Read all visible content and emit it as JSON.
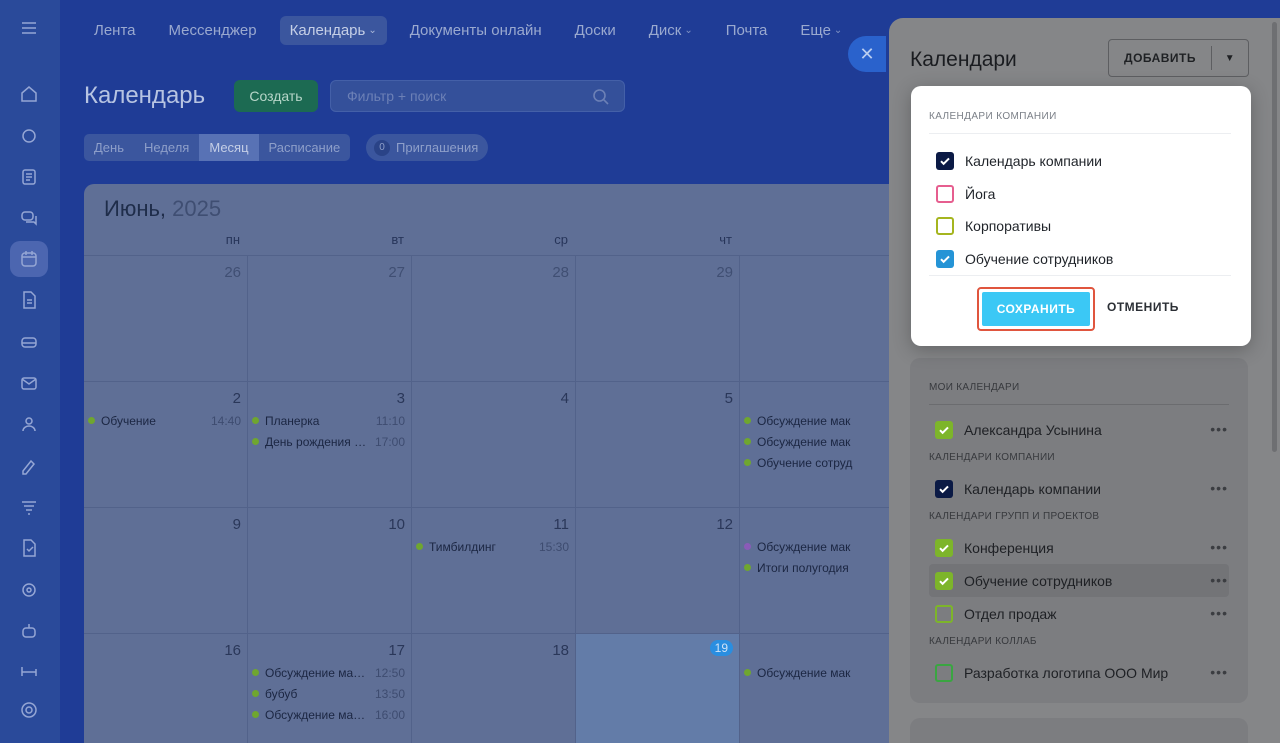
{
  "nav": [
    {
      "label": "Лента",
      "chevron": false,
      "active": false
    },
    {
      "label": "Мессенджер",
      "chevron": false,
      "active": false
    },
    {
      "label": "Календарь",
      "chevron": true,
      "active": true
    },
    {
      "label": "Документы онлайн",
      "chevron": false,
      "active": false
    },
    {
      "label": "Доски",
      "chevron": false,
      "active": false
    },
    {
      "label": "Диск",
      "chevron": true,
      "active": false
    },
    {
      "label": "Почта",
      "chevron": false,
      "active": false
    },
    {
      "label": "Еще",
      "chevron": true,
      "active": false
    }
  ],
  "rail_icons": [
    "menu-icon",
    "home-icon",
    "puzzle-icon",
    "news-icon",
    "chat-icon",
    "calendar-icon",
    "document-icon",
    "drive-icon",
    "mail-icon",
    "team-icon",
    "sign-icon",
    "filter-icon",
    "tasks-icon",
    "target-icon",
    "robot-icon",
    "bed-icon",
    "settings-icon"
  ],
  "toolbar": {
    "title": "Календарь",
    "create_label": "Создать",
    "filter_placeholder": "Фильтр + поиск",
    "views": [
      "День",
      "Неделя",
      "Месяц",
      "Расписание"
    ],
    "active_view": "Месяц",
    "invites_count": "0",
    "invites_label": "Приглашения"
  },
  "calendar": {
    "month": "Июнь,",
    "year": "2025",
    "weekdays": [
      "пн",
      "вт",
      "ср",
      "чт",
      ""
    ],
    "weeks": [
      [
        {
          "n": "26",
          "dim": true,
          "events": []
        },
        {
          "n": "27",
          "dim": true,
          "events": []
        },
        {
          "n": "28",
          "dim": true,
          "events": []
        },
        {
          "n": "29",
          "dim": true,
          "events": []
        },
        {
          "n": "",
          "dim": true,
          "events": []
        }
      ],
      [
        {
          "n": "2",
          "events": [
            {
              "title": "Обучение",
              "time": "14:40",
              "color": "#6fa62f"
            }
          ]
        },
        {
          "n": "3",
          "events": [
            {
              "title": "Планерка",
              "time": "11:10",
              "color": "#6fa62f"
            },
            {
              "title": "День рождения к…",
              "time": "17:00",
              "color": "#6fa62f"
            }
          ]
        },
        {
          "n": "4",
          "events": []
        },
        {
          "n": "5",
          "events": []
        },
        {
          "n": "",
          "events": [
            {
              "title": "Обсуждение мак",
              "time": "",
              "color": "#6fa62f"
            },
            {
              "title": "Обсуждение мак",
              "time": "",
              "color": "#6fa62f"
            },
            {
              "title": "Обучение сотруд",
              "time": "",
              "color": "#6fa62f"
            }
          ]
        }
      ],
      [
        {
          "n": "9",
          "events": []
        },
        {
          "n": "10",
          "events": []
        },
        {
          "n": "11",
          "events": [
            {
              "title": "Тимбилдинг",
              "time": "15:30",
              "color": "#6fa62f"
            }
          ]
        },
        {
          "n": "12",
          "events": []
        },
        {
          "n": "",
          "events": [
            {
              "title": "Обсуждение мак",
              "time": "",
              "color": "#8a5bb8"
            },
            {
              "title": "Итоги полугодия",
              "time": "",
              "color": "#6fa62f"
            }
          ]
        }
      ],
      [
        {
          "n": "16",
          "events": []
        },
        {
          "n": "17",
          "events": [
            {
              "title": "Обсуждение мак…",
              "time": "12:50",
              "color": "#6fa62f"
            },
            {
              "title": "бубуб",
              "time": "13:50",
              "color": "#6fa62f"
            },
            {
              "title": "Обсуждение мак…",
              "time": "16:00",
              "color": "#6fa62f"
            }
          ]
        },
        {
          "n": "18",
          "events": []
        },
        {
          "n": "19",
          "today": true,
          "events": []
        },
        {
          "n": "",
          "events": [
            {
              "title": "Обсуждение мак",
              "time": "",
              "color": "#6fa62f"
            }
          ]
        }
      ]
    ]
  },
  "panel": {
    "title": "Календари",
    "add_label": "ДОБАВИТЬ",
    "my_head": "МОИ КАЛЕНДАРИ",
    "my": [
      {
        "name": "Александра Усынина",
        "color": "#7db52a",
        "checked": true
      }
    ],
    "company_head": "КАЛЕНДАРИ КОМПАНИИ",
    "company": [
      {
        "name": "Календарь компании",
        "color": "#0b1a45",
        "checked": true
      }
    ],
    "groups_head": "КАЛЕНДАРИ ГРУПП И ПРОЕКТОВ",
    "groups": [
      {
        "name": "Конференция",
        "color": "#7db52a",
        "checked": true
      },
      {
        "name": "Обучение сотрудников",
        "color": "#7db52a",
        "checked": true,
        "highlight": true
      },
      {
        "name": "Отдел продаж",
        "color": "#7db52a",
        "checked": false
      }
    ],
    "collab_head": "КАЛЕНДАРИ КОЛЛАБ",
    "collab": [
      {
        "name": "Разработка логотипа ООО Мир",
        "color": "#3aa541",
        "checked": false
      }
    ]
  },
  "popup": {
    "head": "КАЛЕНДАРИ КОМПАНИИ",
    "items": [
      {
        "name": "Календарь компании",
        "color": "#0b1a45",
        "checked": true
      },
      {
        "name": "Йога",
        "color": "#e65e8f",
        "checked": false
      },
      {
        "name": "Корпоративы",
        "color": "#a5b51f",
        "checked": false
      },
      {
        "name": "Обучение сотрудников",
        "color": "#2594d6",
        "checked": true
      }
    ],
    "save_label": "СОХРАНИТЬ",
    "cancel_label": "ОТМЕНИТЬ"
  }
}
